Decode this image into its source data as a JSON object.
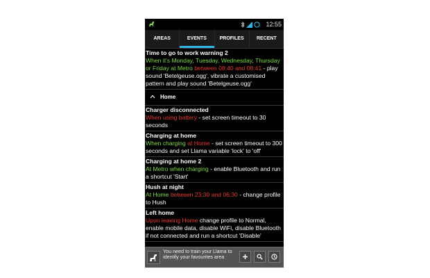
{
  "status_bar": {
    "time": "12:55"
  },
  "tabs": [
    {
      "label": "AREAS",
      "active": false
    },
    {
      "label": "EVENTS",
      "active": true
    },
    {
      "label": "PROFILES",
      "active": false
    },
    {
      "label": "RECENT",
      "active": false
    }
  ],
  "events_top": {
    "title": "Time to go to work warning 2",
    "seg1": "When it's Monday, Tuesday, Wednesday, Thursday or Friday at Metro",
    "seg2": " between 08:40 and 08:41",
    "seg3": " - play sound 'Betelgeuse.ogg', vibrate a customised pattern and play sound 'Betelgeuse.ogg'"
  },
  "group": {
    "label": "Home"
  },
  "events": [
    {
      "title": "Charger disconnected",
      "seg1": "When using battery",
      "seg2": " - set screen timeout to 30 seconds"
    },
    {
      "title": "Charging at home",
      "seg1": "When charging",
      "seg2": " at Home",
      "seg3": " - set screen timeout to 300 seconds and set Llama variable 'lock' to 'off'"
    },
    {
      "title": "Charging at home 2",
      "seg1": "At Metro when charging",
      "seg2": " - enable Bluetooth and run a shortcut 'Start'"
    },
    {
      "title": "Hush at night",
      "seg1": "At Home",
      "seg2": " between 23:30 and 06:30",
      "seg3": " - change profile to Hush"
    },
    {
      "title": "Left home",
      "seg1": "Upon leaving Home",
      "seg2": " change profile to Normal, enable mobile data, disable WiFi, disable Bluetooth if not connected and run a shortcut 'Disable'"
    }
  ],
  "bottom_bar": {
    "message": "You need to train your Llama to identify your favourites area"
  },
  "colors": {
    "accent": "#33b5e5",
    "condition_green": "#7ddc3a",
    "condition_red": "#e8392e"
  }
}
